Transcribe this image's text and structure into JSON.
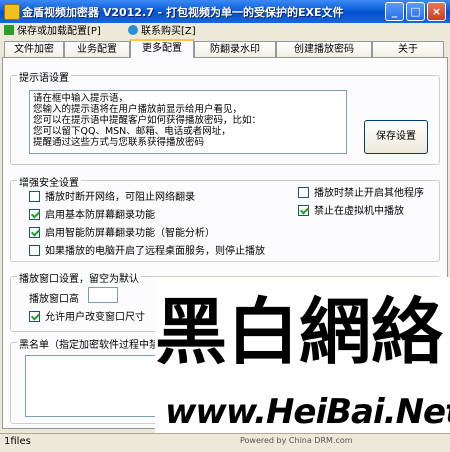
{
  "window": {
    "title": "金盾视频加密器 V2012.7 - 打包视频为单一的受保护的EXE文件"
  },
  "menu": {
    "save_label": "保存或加载配置[P]",
    "contact_label": "联系购买[Z]"
  },
  "tabs": [
    "文件加密",
    "业务配置",
    "更多配置",
    "防翻录水印",
    "创建播放密码",
    "关于"
  ],
  "prompt_group": {
    "title": "提示语设置",
    "text": "请在框中输入提示语，\n您输入的提示语将在用户播放前显示给用户看见，\n您可以在提示语中提醒客户如何获得播放密码，比如：\n您可以留下QQ、MSN、邮箱、电话或者网址，\n提醒通过这些方式与您联系获得播放密码",
    "save_button": "保存设置"
  },
  "security_group": {
    "title": "增强安全设置",
    "options": [
      {
        "label": "播放时断开网络，可阻止网络翻录",
        "checked": false
      },
      {
        "label": "启用基本防屏幕翻录功能",
        "checked": true
      },
      {
        "label": "启用智能防屏幕翻录功能（智能分析）",
        "checked": true
      },
      {
        "label": "如果播放的电脑开启了远程桌面服务，则停止播放",
        "checked": false
      },
      {
        "label": "播放时禁止开启其他程序",
        "checked": false
      },
      {
        "label": "禁止在虚拟机中播放",
        "checked": true
      }
    ]
  },
  "window_group": {
    "title": "播放窗口设置，留空为默认",
    "height_label": "播放窗口高",
    "height_value": "",
    "resize_label": "允许用户改变窗口尺寸",
    "resize_checked": true
  },
  "blacklist_group": {
    "title": "黑名单（指定加密软件过程中禁"
  },
  "watermark": {
    "chars": [
      "黑",
      "白",
      "網",
      "絡"
    ],
    "url": "www.HeiBai.Net"
  },
  "status": {
    "left": "1files",
    "center": "Powered by China DRM.com"
  }
}
